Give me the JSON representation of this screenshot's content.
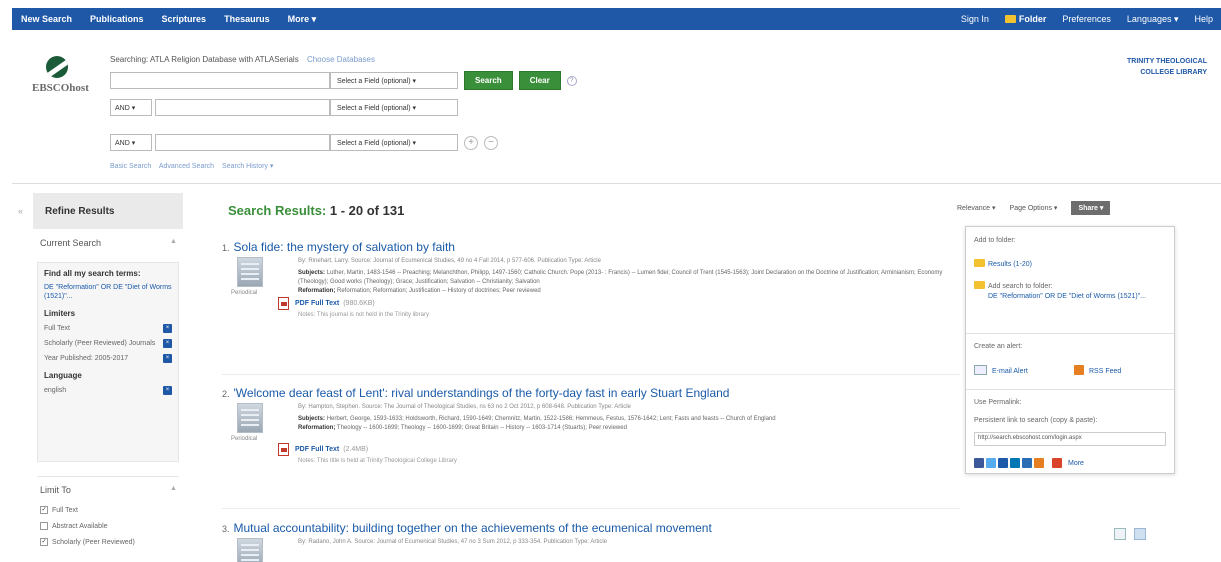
{
  "topbar": {
    "nav": [
      "New Search",
      "Publications",
      "Scriptures",
      "Thesaurus",
      "More ▾"
    ],
    "signin": "Sign In",
    "folder": "Folder",
    "preferences": "Preferences",
    "languages": "Languages ▾",
    "help": "Help"
  },
  "header": {
    "logo_text": "EBSCOhost",
    "searching_label": "Searching: ATLA Religion Database with ATLASerials",
    "choose_db": "Choose Databases",
    "library_line1": "TRINITY THEOLOGICAL",
    "library_line2": "COLLEGE LIBRARY",
    "rows": [
      {
        "bool": "",
        "field": "Select a Field (optional) ▾"
      },
      {
        "bool": "AND ▾",
        "field": "Select a Field (optional) ▾"
      },
      {
        "bool": "AND ▾",
        "field": "Select a Field (optional) ▾"
      }
    ],
    "search_button": "Search",
    "clear_button": "Clear",
    "help_glyph": "?",
    "add_row": "+",
    "remove_row": "−",
    "basic_search": "Basic Search",
    "advanced_search": "Advanced Search",
    "search_history": "Search History ▾"
  },
  "sidebar": {
    "collapse_glyph": "«",
    "refine_title": "Refine Results",
    "current_search": "Current Search",
    "find_all": "Find all my search terms:",
    "query": "DE \"Reformation\" OR DE \"Diet of Worms (1521)\"...",
    "limiters_title": "Limiters",
    "limiters": [
      {
        "label": "Full Text"
      },
      {
        "label": "Scholarly (Peer Reviewed) Journals"
      },
      {
        "label": "Year Published: 2005-2017"
      }
    ],
    "language_title": "Language",
    "languages": [
      {
        "label": "english"
      }
    ],
    "remove_glyph": "×",
    "limit_to": "Limit To",
    "limit_options": [
      {
        "label": "Full Text",
        "checked": "✓"
      },
      {
        "label": "Abstract Available",
        "checked": ""
      },
      {
        "label": "Scholarly (Peer Reviewed)",
        "checked": "✓"
      }
    ]
  },
  "results": {
    "label": "Search Results:",
    "range": "1 - 20 of 131",
    "relevance": "Relevance ▾",
    "page_options": "Page Options ▾",
    "share": "Share ▾",
    "items": [
      {
        "num": "1.",
        "title": "Sola fide: the mystery of salvation by faith",
        "meta": "By: Rinehart, Larry. Source: Journal of Ecumenical Studies, 49 no 4 Fall 2014, p 577-606. Publication Type: Article",
        "subjects": "Luther, Martin, 1483-1546 -- Preaching; Melanchthon, Philipp, 1497-1560; Catholic Church. Pope (2013- : Francis) -- Lumen fidei; Council of Trent (1545-1563); Joint Declaration on the Doctrine of Justification; Arminianism; Economy (Theology); Good works (Theology); Grace; Justification; Salvation -- Christianity; Salvation",
        "reformation": "Reformation; Reformation; Justification -- History of doctrines; Peer reviewed",
        "ptype": "Periodical",
        "pdf": "PDF Full Text",
        "pdf_size": "(980.6KB)",
        "notes": "Notes: This journal is not held in the Trinity library"
      },
      {
        "num": "2.",
        "title": "'Welcome dear feast of Lent': rival understandings of the forty-day fast in early Stuart England",
        "meta": "By: Hampton, Stephen. Source: The Journal of Theological Studies, ns 63 no 2 Oct 2012, p 608-648. Publication Type: Article",
        "subjects": "Herbert, George, 1593-1633; Holdsworth, Richard, 1590-1649; Chemnitz, Martin, 1522-1586; Hemmeus, Festus, 1576-1642; Lent; Fasts and feasts -- Church of England",
        "reformation": "Theology -- 1600-1699; Theology -- 1600-1699; Great Britain -- History -- 1603-1714 (Stuarts); Peer reviewed",
        "ptype": "Periodical",
        "pdf": "PDF Full Text",
        "pdf_size": "(2.4MB)",
        "notes": "Notes: This title is held at Trinity Theological College Library"
      },
      {
        "num": "3.",
        "title": "Mutual accountability: building together on the achievements of the ecumenical movement",
        "meta": "By: Radano, John A. Source: Journal of Ecumenical Studies, 47 no 3 Sum 2012, p 333-354. Publication Type: Article"
      }
    ]
  },
  "share_panel": {
    "add_to_folder": "Add to folder:",
    "results_link": "Results (1-20)",
    "add_search": "Add search to folder:",
    "search_link": "DE \"Reformation\" OR DE \"Diet of Worms (1521)\"...",
    "create_alert": "Create an alert:",
    "email_alert": "E-mail Alert",
    "rss_feed": "RSS Feed",
    "permalink_title": "Use Permalink:",
    "permalink_desc": "Persistent link to search (copy & paste):",
    "permalink_url": "http://search.ebscohost.com/login.aspx",
    "more": "More"
  },
  "colors": {
    "topbar": "#1f58a6",
    "green": "#3a8f3a",
    "link": "#1a5aa8"
  }
}
